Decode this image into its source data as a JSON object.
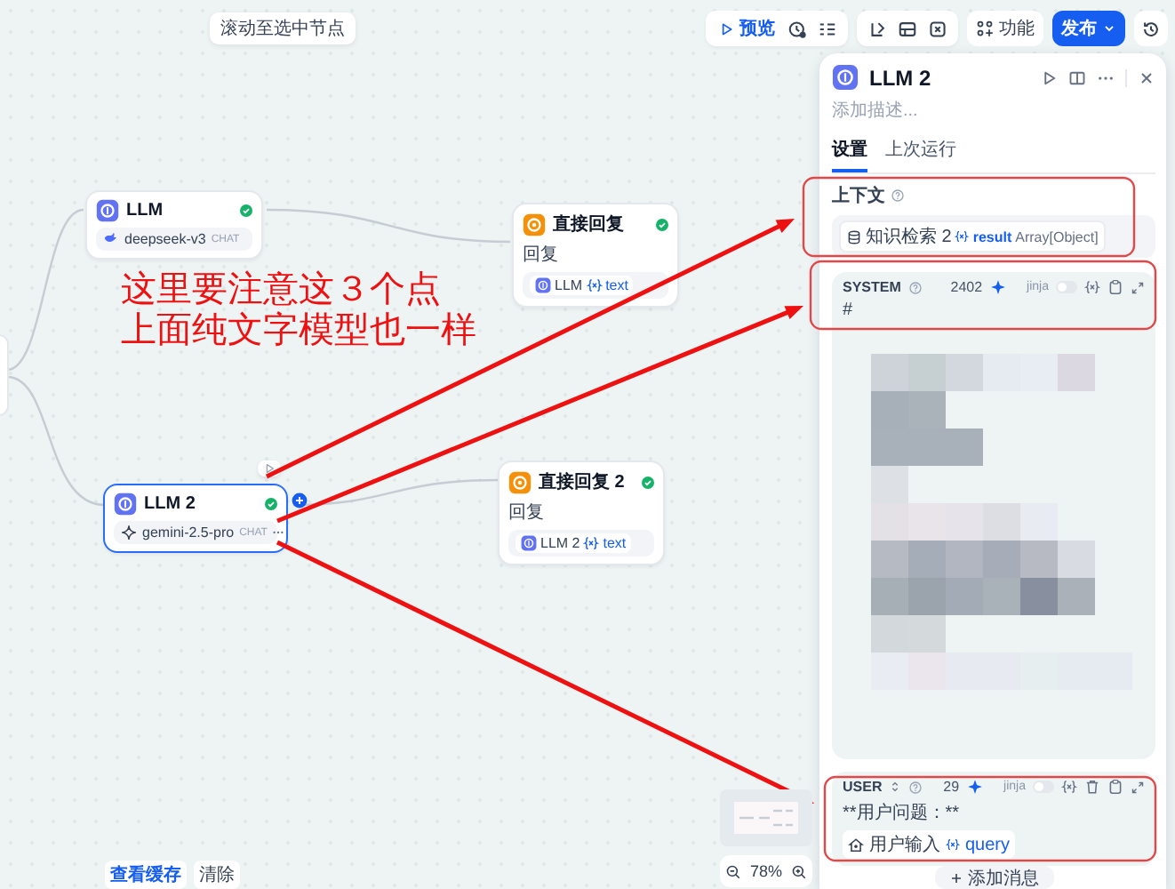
{
  "toolbar": {
    "tooltip": "滚动至选中节点",
    "preview": "预览",
    "features": "功能",
    "publish": "发布"
  },
  "nodes": [
    {
      "kind": "llm",
      "title": "LLM",
      "model": "deepseek-v3",
      "mode": "CHAT",
      "succeeded": true,
      "selected": false
    },
    {
      "kind": "answer",
      "title": "直接回复",
      "label": "回复",
      "ref_node": "LLM",
      "ref_var": "text",
      "succeeded": true,
      "selected": false
    },
    {
      "kind": "llm",
      "title": "LLM 2",
      "model": "gemini-2.5-pro",
      "mode": "CHAT",
      "succeeded": true,
      "selected": true
    },
    {
      "kind": "answer",
      "title": "直接回复 2",
      "label": "回复",
      "ref_node": "LLM 2",
      "ref_var": "text",
      "succeeded": true,
      "selected": false
    }
  ],
  "annotation": {
    "lines": [
      "这里要注意这３个点",
      "上面纯文字模型也一样"
    ]
  },
  "panel": {
    "title": "LLM 2",
    "description_placeholder": "添加描述...",
    "tabs": [
      {
        "label": "设置",
        "selected": true
      },
      {
        "label": "上次运行",
        "selected": false
      }
    ],
    "context": {
      "label": "上下文",
      "source": "知识检索 2",
      "var": "result",
      "type": "Array[Object]"
    },
    "system": {
      "role": "SYSTEM",
      "count": "2402",
      "jinja": "jinja",
      "jinja_on": false,
      "first_line": "#"
    },
    "user": {
      "role": "USER",
      "count": "29",
      "jinja": "jinja",
      "jinja_on": false,
      "line": "**用户问题：**",
      "source": "用户输入",
      "var": "query"
    },
    "add_message": "添加消息"
  },
  "bottom": {
    "view_cache": "查看缓存",
    "clear": "清除"
  },
  "zoom": "78%"
}
